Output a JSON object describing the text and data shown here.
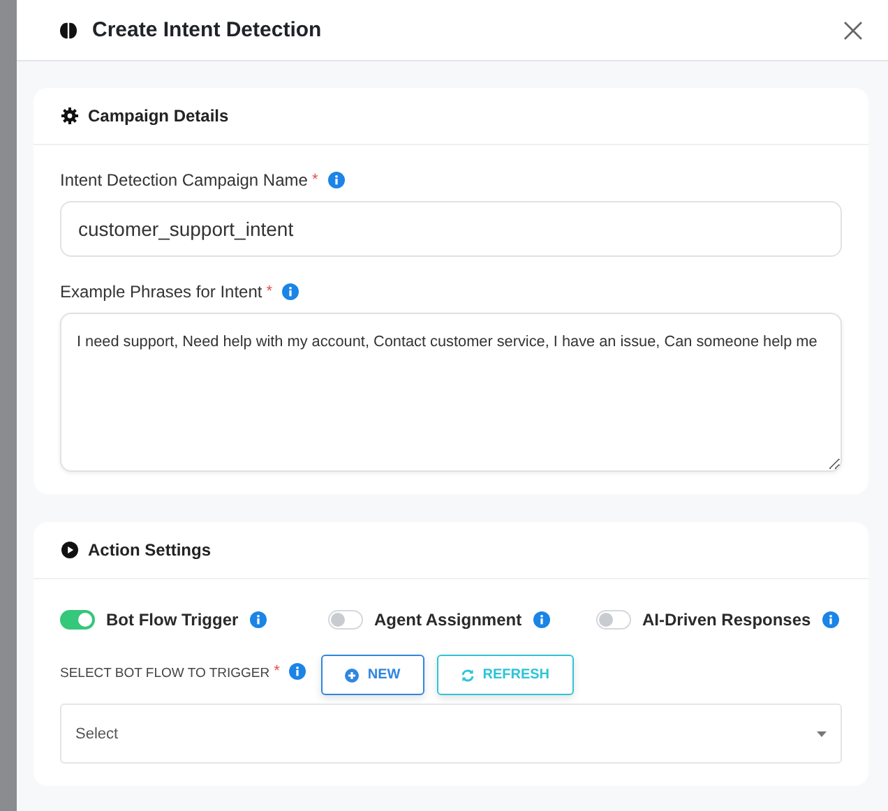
{
  "dialog": {
    "title": "Create Intent Detection"
  },
  "campaign_details": {
    "title": "Campaign Details",
    "name_field": {
      "label": "Intent Detection Campaign Name",
      "required_mark": "*",
      "value": "customer_support_intent"
    },
    "phrases_field": {
      "label": "Example Phrases for Intent",
      "required_mark": "*",
      "value": "I need support, Need help with my account, Contact customer service, I have an issue, Can someone help me"
    }
  },
  "action_settings": {
    "title": "Action Settings",
    "toggles": [
      {
        "label": "Bot Flow Trigger",
        "on": true
      },
      {
        "label": "Agent Assignment",
        "on": false
      },
      {
        "label": "AI-Driven Responses",
        "on": false
      }
    ],
    "bot_flow": {
      "label": "SELECT BOT FLOW TO TRIGGER",
      "required_mark": "*",
      "buttons": [
        {
          "kind": "new",
          "label": "NEW"
        },
        {
          "kind": "refresh",
          "label": "REFRESH"
        }
      ],
      "select_placeholder": "Select"
    }
  }
}
